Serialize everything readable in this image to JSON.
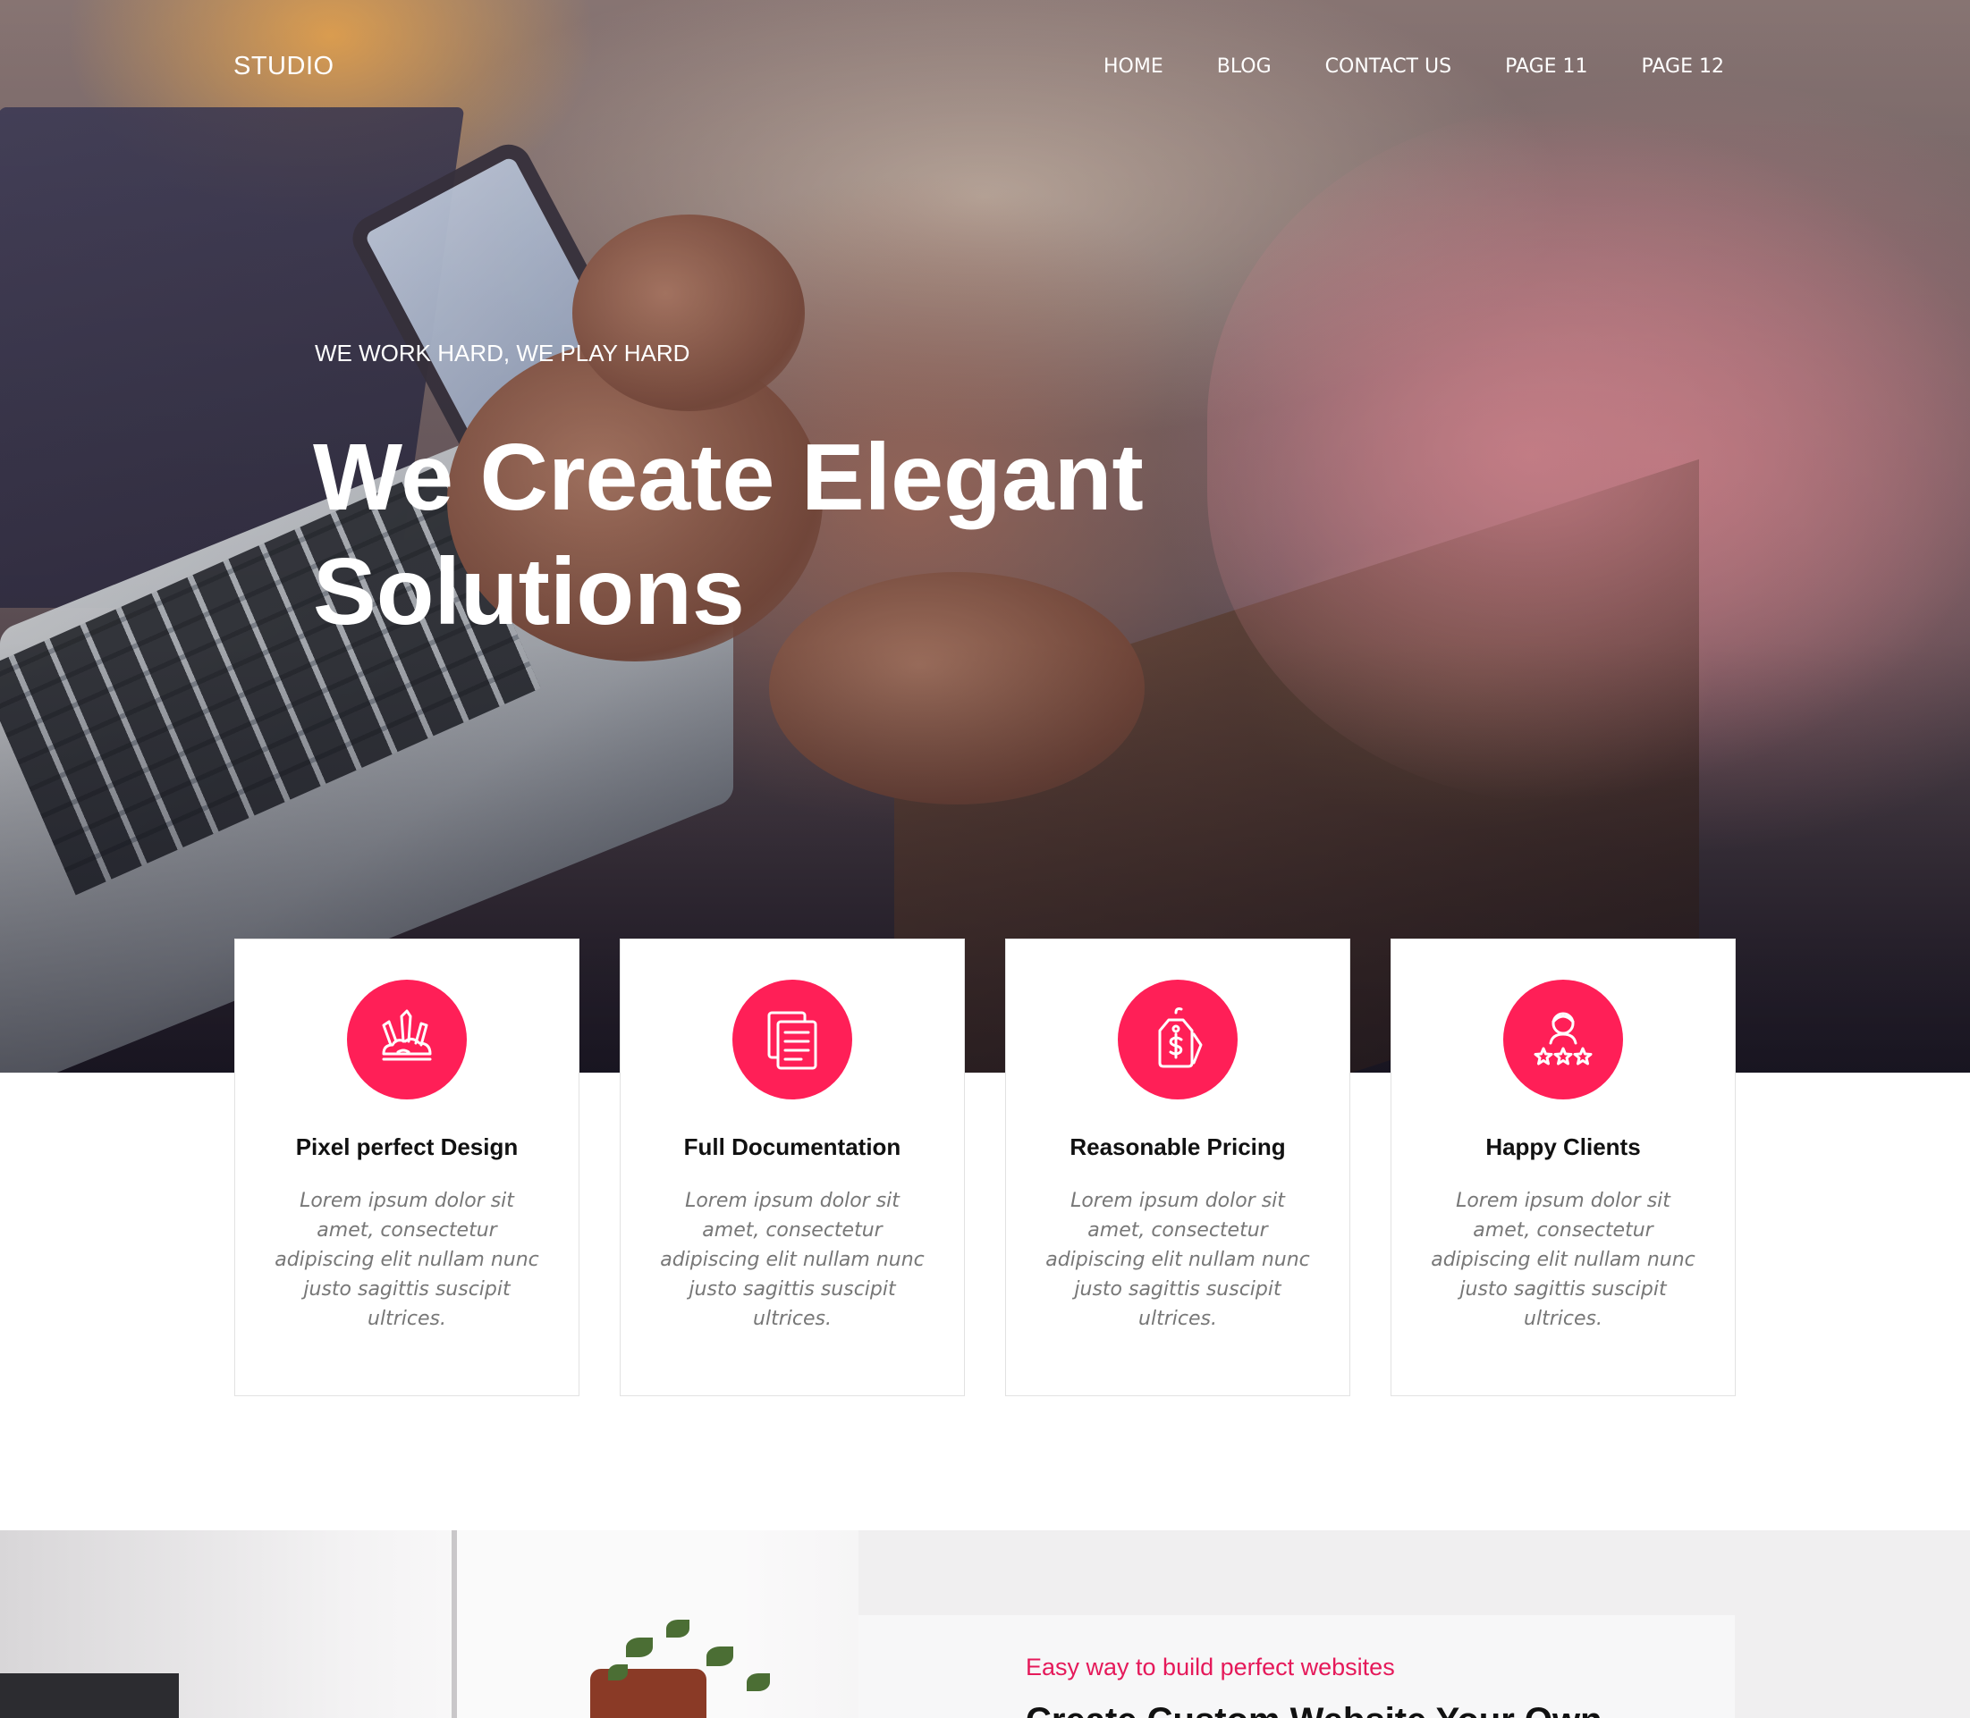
{
  "brand": {
    "logo": "STUDIO",
    "accent": "#ff1f57"
  },
  "nav": [
    {
      "label": "HOME"
    },
    {
      "label": "BLOG"
    },
    {
      "label": "CONTACT US"
    },
    {
      "label": "PAGE 11"
    },
    {
      "label": "PAGE 12"
    }
  ],
  "hero": {
    "eyebrow": "WE WORK HARD, WE PLAY HARD",
    "title": "We Create Elegant Solutions"
  },
  "features": [
    {
      "icon": "brushes-icon",
      "title": "Pixel perfect Design",
      "text": "Lorem ipsum dolor sit amet, consectetur adipiscing elit nullam nunc justo sagittis suscipit ultrices."
    },
    {
      "icon": "documents-icon",
      "title": "Full Documentation",
      "text": "Lorem ipsum dolor sit amet, consectetur adipiscing elit nullam nunc justo sagittis suscipit ultrices."
    },
    {
      "icon": "price-tag-icon",
      "title": "Reasonable Pricing",
      "text": "Lorem ipsum dolor sit amet, consectetur adipiscing elit nullam nunc justo sagittis suscipit ultrices."
    },
    {
      "icon": "happy-client-icon",
      "title": "Happy Clients",
      "text": "Lorem ipsum dolor sit amet, consectetur adipiscing elit nullam nunc justo sagittis suscipit ultrices."
    }
  ],
  "about": {
    "subtitle": "Easy way to build perfect websites",
    "heading": "Create Custom Website Your Own"
  }
}
